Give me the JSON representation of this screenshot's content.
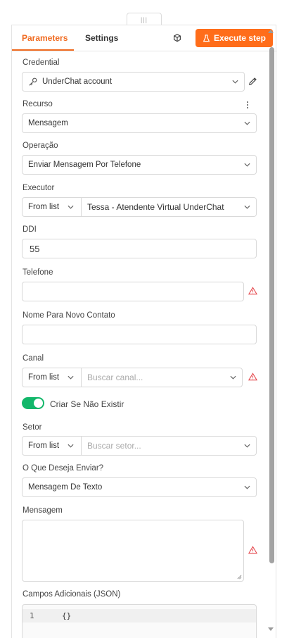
{
  "handle": {
    "glyph": "|||"
  },
  "tabs": {
    "parameters": "Parameters",
    "settings": "Settings"
  },
  "execute_button": "Execute step",
  "credential": {
    "label": "Credential",
    "value": "UnderChat account"
  },
  "recurso": {
    "label": "Recurso",
    "value": "Mensagem"
  },
  "operacao": {
    "label": "Operação",
    "value": "Enviar Mensagem Por Telefone"
  },
  "executor": {
    "label": "Executor",
    "mode": "From list",
    "value": "Tessa - Atendente Virtual UnderChat"
  },
  "ddi": {
    "label": "DDI",
    "value": "55"
  },
  "telefone": {
    "label": "Telefone",
    "value": ""
  },
  "nome_contato": {
    "label": "Nome Para Novo Contato",
    "value": ""
  },
  "canal": {
    "label": "Canal",
    "mode": "From list",
    "placeholder": "Buscar canal..."
  },
  "criar": {
    "label": "Criar Se Não Existir",
    "on": true
  },
  "setor": {
    "label": "Setor",
    "mode": "From list",
    "placeholder": "Buscar setor..."
  },
  "deseja_enviar": {
    "label": "O Que Deseja Enviar?",
    "value": "Mensagem De Texto"
  },
  "mensagem": {
    "label": "Mensagem",
    "value": ""
  },
  "campos": {
    "label": "Campos Adicionais (JSON)",
    "line_number": "1",
    "code": "{}"
  },
  "colors": {
    "accent": "#ff6d1a",
    "toggle_on": "#12b76a",
    "warning": "#e5484d"
  }
}
